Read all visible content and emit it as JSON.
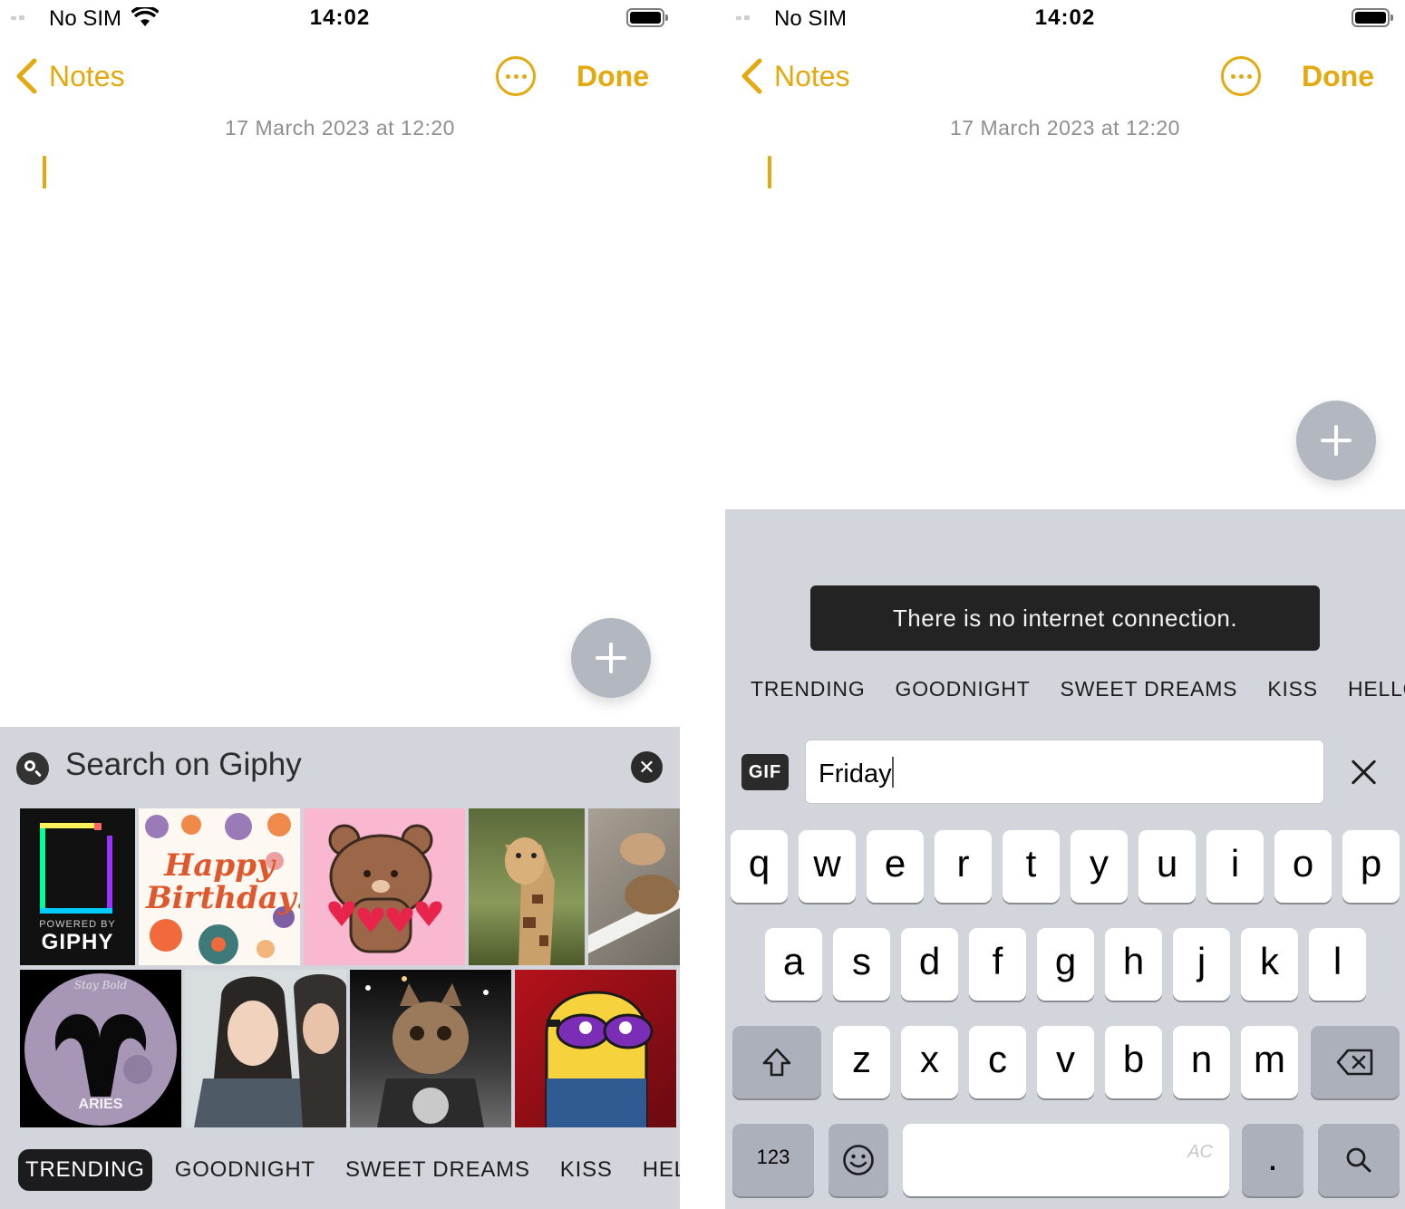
{
  "status_bar": {
    "carrier": "No SIM",
    "time": "14:02"
  },
  "nav": {
    "back_label": "Notes",
    "done_label": "Done"
  },
  "note": {
    "date": "17 March 2023 at 12:20"
  },
  "giphy_panel": {
    "search_placeholder": "Search on Giphy",
    "clear_icon": "x-circle-icon",
    "gifs": [
      {
        "name": "gif-powered-by-giphy",
        "label_top": "POWERED BY",
        "label": "GIPHY"
      },
      {
        "name": "gif-happy-birthday",
        "label": "Happy Birthday!"
      },
      {
        "name": "gif-bear-hearts"
      },
      {
        "name": "gif-giraffe"
      },
      {
        "name": "gif-tortoise"
      },
      {
        "name": "gif-aries-moon",
        "label_top": "Stay Bold",
        "label": "ARIES"
      },
      {
        "name": "gif-girls"
      },
      {
        "name": "gif-cat-motorcycle"
      },
      {
        "name": "gif-minion"
      }
    ],
    "categories": [
      "TRENDING",
      "GOODNIGHT",
      "SWEET DREAMS",
      "KISS",
      "HELLO"
    ],
    "active_category": "TRENDING"
  },
  "search_keyboard": {
    "toast": "There is no internet connection.",
    "categories": [
      "TRENDING",
      "GOODNIGHT",
      "SWEET DREAMS",
      "KISS",
      "HELLO"
    ],
    "gif_badge": "GIF",
    "query": "Friday",
    "rows": [
      [
        "q",
        "w",
        "e",
        "r",
        "t",
        "y",
        "u",
        "i",
        "o",
        "p"
      ],
      [
        "a",
        "s",
        "d",
        "f",
        "g",
        "h",
        "j",
        "k",
        "l"
      ],
      [
        "z",
        "x",
        "c",
        "v",
        "b",
        "n",
        "m"
      ]
    ],
    "numbers_key": "123",
    "period_key": ".",
    "space_badge": "AC",
    "icons": [
      "shift-icon",
      "backspace-icon",
      "emoji-icon",
      "search-icon",
      "close-icon"
    ]
  },
  "colors": {
    "accent": "#e3a90f",
    "keyboard_bg": "#d2d5db",
    "fab": "#b3b8c0"
  }
}
